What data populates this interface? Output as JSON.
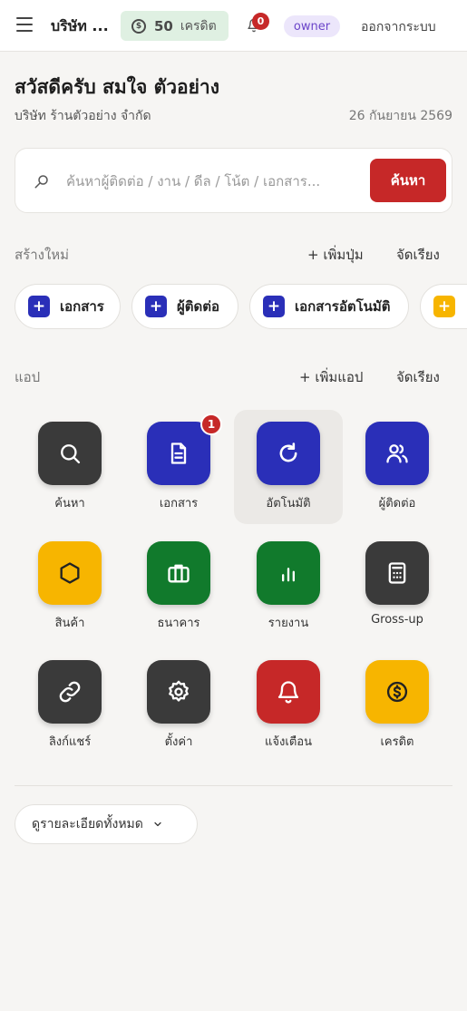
{
  "header": {
    "company_name": "บริษัท ...",
    "credits": "50",
    "credits_label": "เครดิต",
    "notification_count": "0",
    "role": "owner",
    "logout_label": "ออกจากระบบ"
  },
  "greeting": {
    "title": "สวัสดีครับ สมใจ ตัวอย่าง",
    "company": "บริษัท ร้านตัวอย่าง จำกัด",
    "date": "26 กันยายน 2569"
  },
  "search": {
    "placeholder": "ค้นหาผู้ติดต่อ / งาน / ดีล / โน้ต / เอกสาร...",
    "button_label": "ค้นหา"
  },
  "quick_create": {
    "title": "สร้างใหม่",
    "add_label": "+ เพิ่มปุ่ม",
    "sort_label": "จัดเรียง",
    "chips": [
      {
        "label": "เอกสาร"
      },
      {
        "label": "ผู้ติดต่อ"
      },
      {
        "label": "เอกสารอัตโนมัติ"
      },
      {
        "label": ""
      }
    ]
  },
  "apps": {
    "title": "แอป",
    "add_label": "+ เพิ่มแอป",
    "sort_label": "จัดเรียง",
    "items": [
      {
        "label": "ค้นหา",
        "icon": "search-icon",
        "color": "#3a3a3a"
      },
      {
        "label": "เอกสาร",
        "icon": "document-icon",
        "color": "#2a2fb8",
        "badge": "1"
      },
      {
        "label": "อัตโนมัติ",
        "icon": "refresh-icon",
        "color": "#2a2fb8",
        "selected": true
      },
      {
        "label": "ผู้ติดต่อ",
        "icon": "users-icon",
        "color": "#2a2fb8"
      },
      {
        "label": "สินค้า",
        "icon": "hexagon-icon",
        "color": "#f7b500"
      },
      {
        "label": "ธนาคาร",
        "icon": "briefcase-icon",
        "color": "#117a2c"
      },
      {
        "label": "รายงาน",
        "icon": "bar-chart-icon",
        "color": "#117a2c"
      },
      {
        "label": "Gross-up",
        "icon": "calculator-icon",
        "color": "#3a3a3a"
      },
      {
        "label": "ลิงก์แชร์",
        "icon": "link-icon",
        "color": "#3a3a3a"
      },
      {
        "label": "ตั้งค่า",
        "icon": "gear-icon",
        "color": "#3a3a3a"
      },
      {
        "label": "แจ้งเตือน",
        "icon": "bell-icon",
        "color": "#c62828"
      },
      {
        "label": "เครดิต",
        "icon": "coin-icon",
        "color": "#f7b500"
      }
    ]
  },
  "footer": {
    "details_label": "ดูรายละเอียดทั้งหมด"
  }
}
